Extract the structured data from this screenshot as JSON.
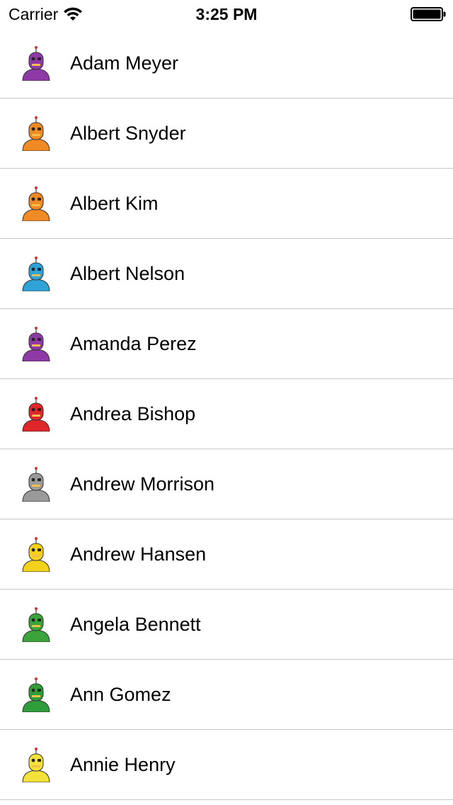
{
  "status_bar": {
    "carrier": "Carrier",
    "time": "3:25 PM",
    "wifi_icon": "wifi-icon",
    "battery_icon": "battery-icon"
  },
  "contacts": [
    {
      "name": "Adam Meyer",
      "avatar_icon": "robot-avatar-icon",
      "color": "#8e3aa6"
    },
    {
      "name": "Albert Snyder",
      "avatar_icon": "robot-avatar-icon",
      "color": "#f08a24"
    },
    {
      "name": "Albert Kim",
      "avatar_icon": "robot-avatar-icon",
      "color": "#f08a24"
    },
    {
      "name": "Albert Nelson",
      "avatar_icon": "robot-avatar-icon",
      "color": "#2ea3d8"
    },
    {
      "name": "Amanda Perez",
      "avatar_icon": "robot-avatar-icon",
      "color": "#8e3aa6"
    },
    {
      "name": "Andrea Bishop",
      "avatar_icon": "robot-avatar-icon",
      "color": "#e0262b"
    },
    {
      "name": "Andrew Morrison",
      "avatar_icon": "robot-avatar-icon",
      "color": "#9a9a9a"
    },
    {
      "name": "Andrew Hansen",
      "avatar_icon": "robot-avatar-icon",
      "color": "#f4d21c"
    },
    {
      "name": "Angela Bennett",
      "avatar_icon": "robot-avatar-icon",
      "color": "#3aa33a"
    },
    {
      "name": "Ann Gomez",
      "avatar_icon": "robot-avatar-icon",
      "color": "#2f9e3a"
    },
    {
      "name": "Annie Henry",
      "avatar_icon": "robot-avatar-icon",
      "color": "#f2e23a"
    }
  ]
}
